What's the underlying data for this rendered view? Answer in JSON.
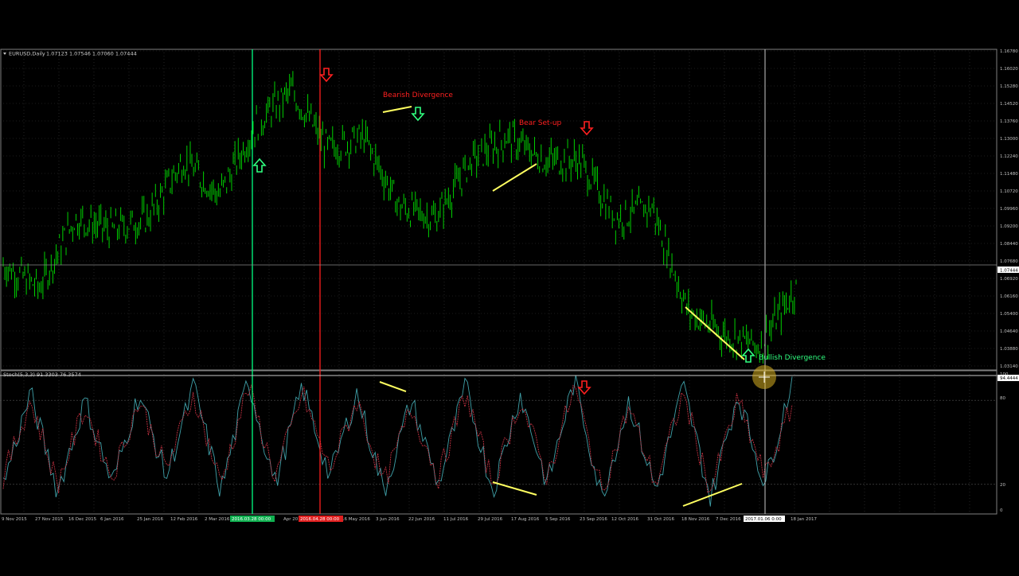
{
  "main_chart": {
    "symbol_header": "EURUSD,Daily",
    "ohlc": "1.07123 1.07546 1.07060 1.07444",
    "current_price_label": "1.07444",
    "annotations": {
      "bearish_divergence": "Bearish Divergence",
      "bear_setup": "Bear Set-up",
      "bullish_divergence": "Bullish Divergence"
    }
  },
  "indicator": {
    "header": "Stoch(5,3,3) 91.3303 76.3574",
    "scale_labels": [
      "100",
      "80",
      "20",
      "0"
    ],
    "current_value_label": "94.4444"
  },
  "x_axis": {
    "highlight_green": "2016.03.28 00:00",
    "highlight_red": "2016.04.28 00:00",
    "highlight_cursor": "2017.01.06 0:00"
  },
  "colors": {
    "background": "#000000",
    "candles": "#00d000",
    "annotation_red": "#ff2020",
    "arrow_green": "#30ff80",
    "trendline": "#ffff60",
    "stoch_main": "#3fa0a8",
    "stoch_signal": "#c03040",
    "grid": "#3a3a3a",
    "vline_green": "#00ff80",
    "vline_red": "#ff2020"
  },
  "chart_data": [
    {
      "type": "line",
      "title": "EURUSD,Daily",
      "x": [
        "9 Nov 2015",
        "27 Nov 2015",
        "16 Dec 2015",
        "6 Jan 2016",
        "25 Jan 2016",
        "12 Feb 2016",
        "2 Mar 2016",
        "28 Mar 2016",
        "Apr 2016",
        "16 May 2016",
        "3 Jun 2016",
        "22 Jun 2016",
        "11 Jul 2016",
        "29 Jul 2016",
        "17 Aug 2016",
        "5 Sep 2016",
        "23 Sep 2016",
        "12 Oct 2016",
        "31 Oct 2016",
        "18 Nov 2016",
        "7 Dec 2016",
        "6 Jan 2017",
        "18 Jan 2017"
      ],
      "series": [
        {
          "values": [
            1.075,
            1.065,
            1.095,
            1.09,
            1.095,
            1.12,
            1.105,
            1.135,
            1.15,
            1.125,
            1.13,
            1.1,
            1.095,
            1.12,
            1.13,
            1.12,
            1.12,
            1.095,
            1.1,
            1.055,
            1.045,
            1.04,
            1.065
          ]
        }
      ],
      "y_tick_labels": [
        "1.16780",
        "1.16020",
        "1.15280",
        "1.14520",
        "1.13760",
        "1.13000",
        "1.12240",
        "1.11480",
        "1.10720",
        "1.09960",
        "1.09200",
        "1.08440",
        "1.07680",
        "1.06920",
        "1.06160",
        "1.05400",
        "1.04640",
        "1.03880",
        "1.03140"
      ],
      "ylim": [
        1.0314,
        1.1678
      ],
      "x_tick_labels": [
        "9 Nov 2015",
        "27 Nov 2015",
        "16 Dec 2015",
        "6 Jan 2016",
        "25 Jan 2016",
        "12 Feb 2016",
        "2 Mar 2016",
        "Apr 2016",
        "16 May 2016",
        "3 Jun 2016",
        "22 Jun 2016",
        "11 Jul 2016",
        "29 Jul 2016",
        "17 Aug 2016",
        "5 Sep 2016",
        "23 Sep 2016",
        "12 Oct 2016",
        "31 Oct 2016",
        "18 Nov 2016",
        "7 Dec 2016",
        "18 Jan 2017"
      ],
      "grid": true
    },
    {
      "type": "line",
      "title": "Stoch(5,3,3) 91.3303 76.3574",
      "series": [
        {
          "values": [
            20,
            85,
            15,
            80,
            20,
            85,
            25,
            90,
            15,
            95,
            20,
            90,
            25,
            85,
            15,
            80,
            20,
            90,
            15,
            85,
            20,
            95,
            10,
            80,
            15,
            90,
            10,
            85,
            20,
            95
          ]
        },
        {
          "values": [
            25,
            80,
            20,
            75,
            25,
            80,
            30,
            85,
            20,
            90,
            25,
            85,
            30,
            80,
            20,
            75,
            25,
            85,
            20,
            80,
            25,
            90,
            15,
            75,
            20,
            85,
            15,
            80,
            25,
            76
          ]
        }
      ],
      "ylim": [
        0,
        100
      ],
      "grid": true
    }
  ]
}
